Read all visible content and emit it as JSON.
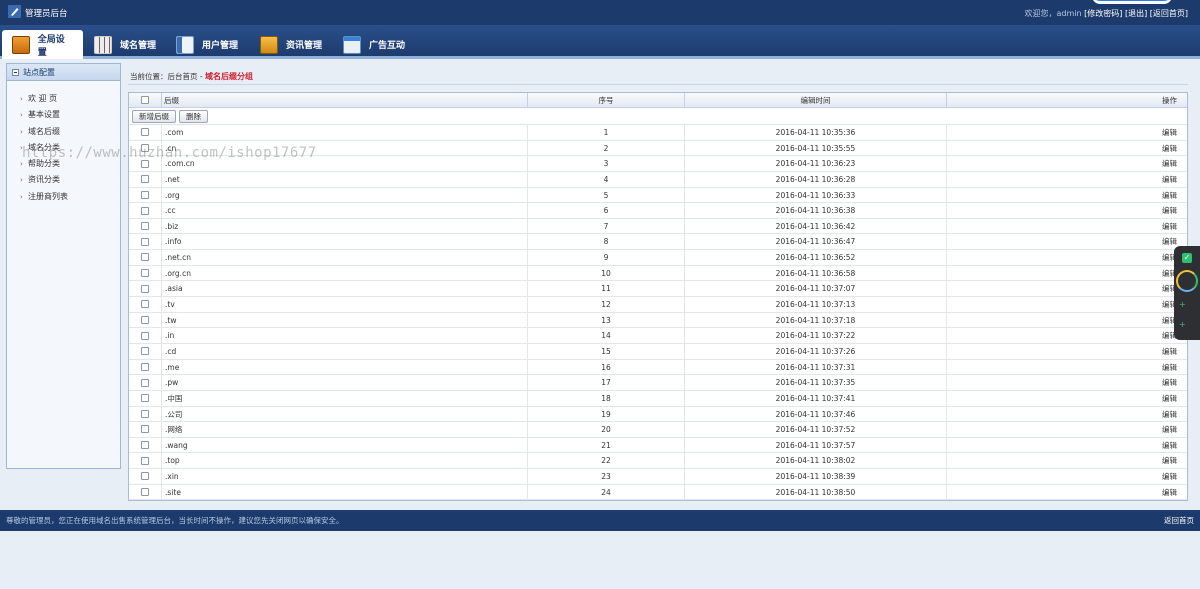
{
  "header": {
    "app_title": "管理员后台",
    "welcome": "欢迎您，admin",
    "links": [
      "[修改密码]",
      "[退出]",
      "[返回首页]"
    ]
  },
  "nav": {
    "tabs": [
      {
        "label": "全局设置",
        "icon": "settings-folder-icon",
        "active": true
      },
      {
        "label": "域名管理",
        "icon": "domain-grid-icon",
        "active": false
      },
      {
        "label": "用户管理",
        "icon": "user-card-icon",
        "active": false
      },
      {
        "label": "资讯管理",
        "icon": "news-box-icon",
        "active": false
      },
      {
        "label": "广告互动",
        "icon": "ad-window-icon",
        "active": false
      }
    ]
  },
  "sidebar": {
    "title": "站点配置",
    "items": [
      "欢 迎 页",
      "基本设置",
      "域名后缀",
      "域名分类",
      "帮助分类",
      "资讯分类",
      "注册商列表"
    ]
  },
  "breadcrumb": {
    "prefix": "当前位置：后台首页 - ",
    "current": "域名后缀分组"
  },
  "table": {
    "columns": {
      "suffix": "后缀",
      "seq": "序号",
      "time": "编辑时间",
      "op": "操作"
    },
    "buttons": {
      "add": "新增后缀",
      "delete": "删除"
    },
    "edit_label": "编辑",
    "rows": [
      {
        "suffix": ".com",
        "seq": "1",
        "time": "2016-04-11 10:35:36"
      },
      {
        "suffix": ".cn",
        "seq": "2",
        "time": "2016-04-11 10:35:55"
      },
      {
        "suffix": ".com.cn",
        "seq": "3",
        "time": "2016-04-11 10:36:23"
      },
      {
        "suffix": ".net",
        "seq": "4",
        "time": "2016-04-11 10:36:28"
      },
      {
        "suffix": ".org",
        "seq": "5",
        "time": "2016-04-11 10:36:33"
      },
      {
        "suffix": ".cc",
        "seq": "6",
        "time": "2016-04-11 10:36:38"
      },
      {
        "suffix": ".biz",
        "seq": "7",
        "time": "2016-04-11 10:36:42"
      },
      {
        "suffix": ".info",
        "seq": "8",
        "time": "2016-04-11 10:36:47"
      },
      {
        "suffix": ".net.cn",
        "seq": "9",
        "time": "2016-04-11 10:36:52"
      },
      {
        "suffix": ".org.cn",
        "seq": "10",
        "time": "2016-04-11 10:36:58"
      },
      {
        "suffix": ".asia",
        "seq": "11",
        "time": "2016-04-11 10:37:07"
      },
      {
        "suffix": ".tv",
        "seq": "12",
        "time": "2016-04-11 10:37:13"
      },
      {
        "suffix": ".tw",
        "seq": "13",
        "time": "2016-04-11 10:37:18"
      },
      {
        "suffix": ".in",
        "seq": "14",
        "time": "2016-04-11 10:37:22"
      },
      {
        "suffix": ".cd",
        "seq": "15",
        "time": "2016-04-11 10:37:26"
      },
      {
        "suffix": ".me",
        "seq": "16",
        "time": "2016-04-11 10:37:31"
      },
      {
        "suffix": ".pw",
        "seq": "17",
        "time": "2016-04-11 10:37:35"
      },
      {
        "suffix": ".中国",
        "seq": "18",
        "time": "2016-04-11 10:37:41"
      },
      {
        "suffix": ".公司",
        "seq": "19",
        "time": "2016-04-11 10:37:46"
      },
      {
        "suffix": ".网络",
        "seq": "20",
        "time": "2016-04-11 10:37:52"
      },
      {
        "suffix": ".wang",
        "seq": "21",
        "time": "2016-04-11 10:37:57"
      },
      {
        "suffix": ".top",
        "seq": "22",
        "time": "2016-04-11 10:38:02"
      },
      {
        "suffix": ".xin",
        "seq": "23",
        "time": "2016-04-11 10:38:39"
      },
      {
        "suffix": ".site",
        "seq": "24",
        "time": "2016-04-11 10:38:50"
      }
    ]
  },
  "footer": {
    "notice": "尊敬的管理员，您正在使用域名出售系统管理后台，当长时间不操作，建议您先关闭网页以确保安全。",
    "back_link": "返回首页"
  },
  "watermark": "https://www.huzhan.com/ishop17677",
  "colors": {
    "header_bg": "#1c3a6b",
    "page_bg": "#e8eef6",
    "breadcrumb_current": "#d0202f",
    "widget_check": "#2fbf71"
  }
}
